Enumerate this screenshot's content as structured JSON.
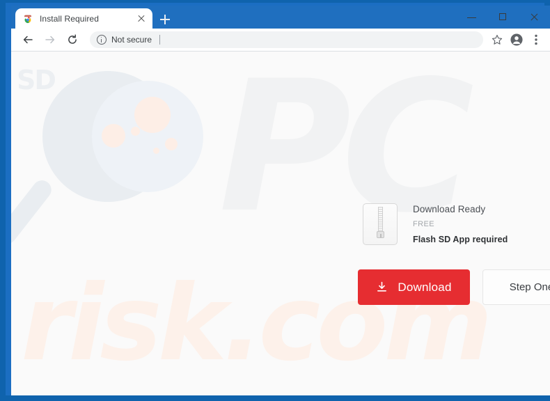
{
  "browser": {
    "tab": {
      "title": "Install Required",
      "favicon": "chrome-app-icon",
      "close_icon": "close-icon"
    },
    "new_tab_label": "+",
    "window_controls": {
      "minimize": "minimize-icon",
      "maximize": "maximize-icon",
      "close": "close-icon"
    },
    "toolbar": {
      "back": "back-arrow-icon",
      "forward": "forward-arrow-icon",
      "reload": "reload-icon",
      "security_icon": "info-circle-icon",
      "security_label": "Not secure",
      "address_value": "",
      "address_placeholder": "",
      "bookmark": "star-icon",
      "profile": "account-avatar-icon",
      "menu": "three-dot-menu-icon"
    },
    "frame_color": "#0f63ad",
    "tabstrip_color": "#1f6fbf"
  },
  "page": {
    "watermarks": {
      "logo_text": "SD",
      "brand_big": "PC",
      "brand_small": "risk.com",
      "magnifier": "magnifying-glass-watermark"
    },
    "card": {
      "file_icon": "zip-archive-icon",
      "title": "Download Ready",
      "price": "FREE",
      "requirement": "Flash SD App required"
    },
    "buttons": {
      "download_label": "Download",
      "download_icon": "download-arrow-icon",
      "download_color": "#e62d31",
      "step_label": "Step One"
    },
    "background_color": "#fafafa"
  }
}
